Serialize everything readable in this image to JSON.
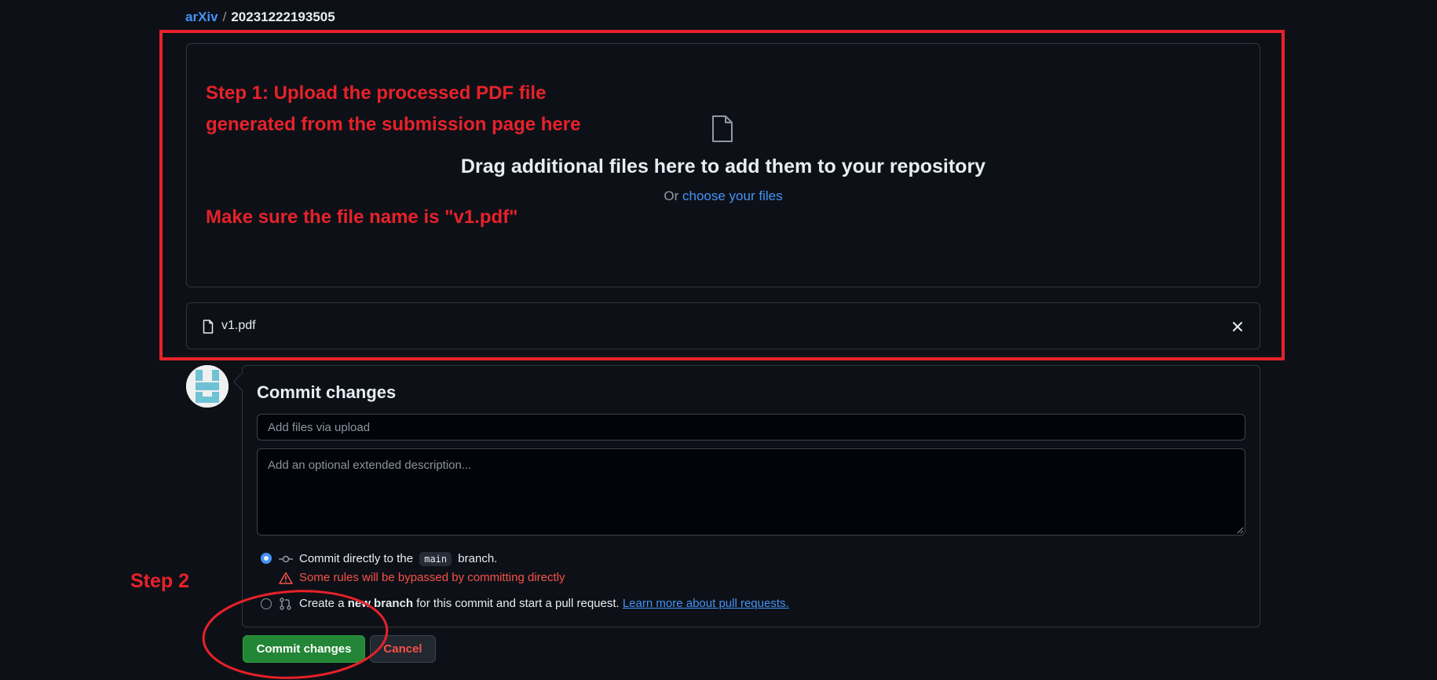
{
  "breadcrumb": {
    "owner": "arXiv",
    "separator": "/",
    "repo": "20231222193505"
  },
  "dropzone": {
    "icon": "file-icon",
    "title": "Drag additional files here to add them to your repository",
    "prefix": "Or",
    "link": "choose your files"
  },
  "annotations": {
    "step1": "Step 1: Upload the processed PDF file generated from the submission page here",
    "filename_note": "Make sure the file name is \"v1.pdf\"",
    "step2": "Step 2",
    "color": "#e8212a"
  },
  "file": {
    "name": "v1.pdf",
    "remove_icon": "close-icon"
  },
  "commit": {
    "title": "Commit changes",
    "summary_placeholder": "Add files via upload",
    "description_placeholder": "Add an optional extended description...",
    "option_direct": {
      "selected": true,
      "prefix": "Commit directly to the",
      "branch": "main",
      "suffix": "branch.",
      "icon": "git-commit-icon"
    },
    "warning": {
      "icon": "alert-icon",
      "text": "Some rules will be bypassed by committing directly"
    },
    "option_new_branch": {
      "selected": false,
      "prefix": "Create a",
      "bold": "new branch",
      "middle": "for this commit and start a pull request.",
      "link": "Learn more about pull requests.",
      "icon": "git-pull-request-icon"
    },
    "commit_button": "Commit changes",
    "cancel_button": "Cancel"
  },
  "colors": {
    "background": "#0d1117",
    "accent": "#4493f8",
    "success": "#238636",
    "danger": "#f85149"
  }
}
